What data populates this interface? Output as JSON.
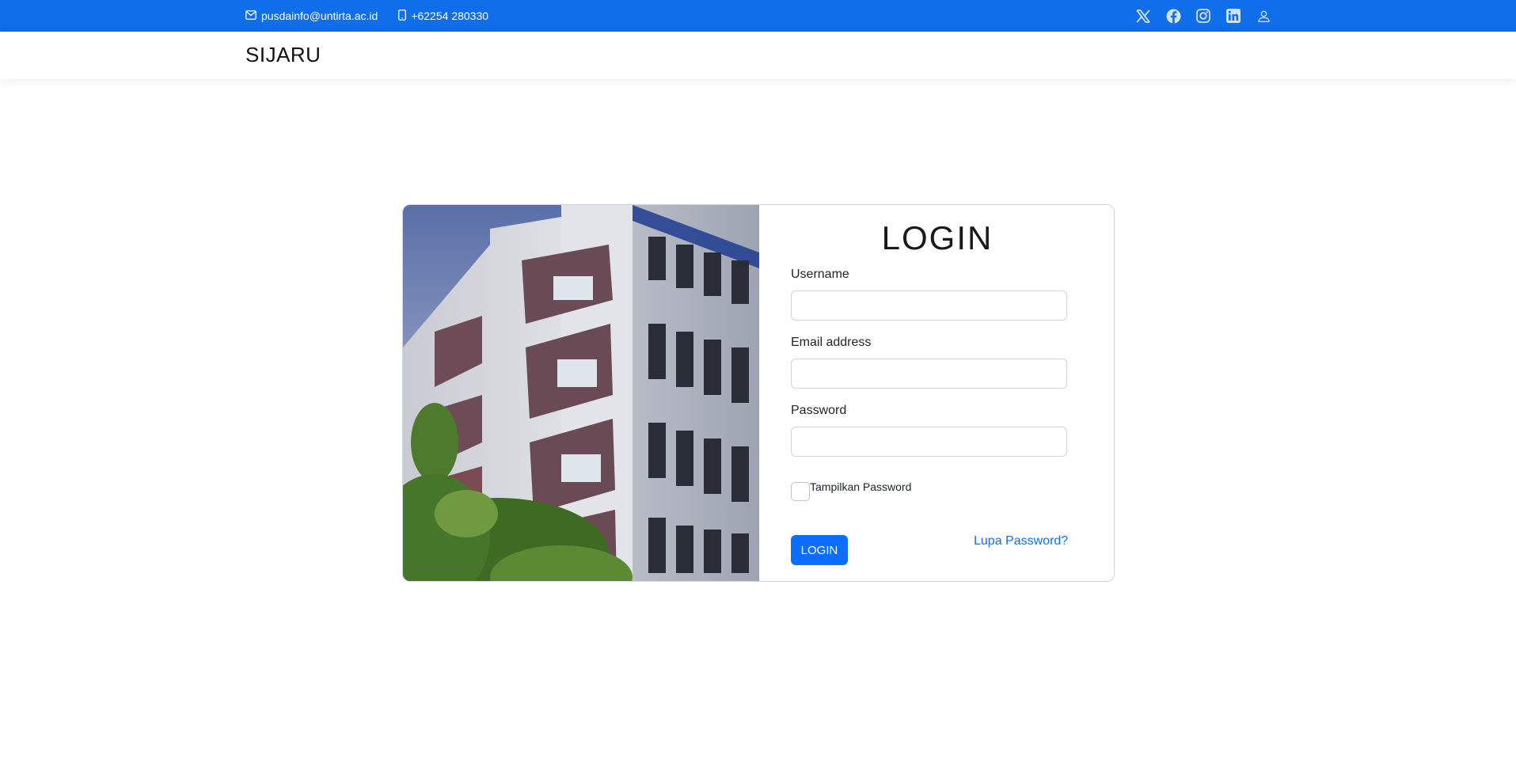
{
  "topbar": {
    "email": "pusdainfo@untirta.ac.id",
    "phone": "+62254 280330",
    "icons": [
      "envelope-icon",
      "phone-icon",
      "x-twitter-icon",
      "facebook-icon",
      "instagram-icon",
      "linkedin-icon",
      "user-icon"
    ],
    "color": "#106eea"
  },
  "navbar": {
    "brand": "SIJARU"
  },
  "login": {
    "title": "LOGIN",
    "username_label": "Username",
    "username_value": "",
    "email_label": "Email address",
    "email_value": "",
    "password_label": "Password",
    "password_value": "",
    "show_password_label": "Tampilkan Password",
    "show_password_checked": false,
    "submit_label": "LOGIN",
    "forgot_label": "Lupa Password?",
    "accent": "#0d6efd"
  }
}
